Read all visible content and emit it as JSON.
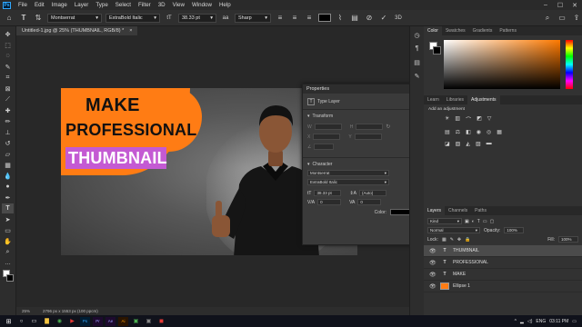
{
  "menu": {
    "logo": "Ps",
    "items": [
      "File",
      "Edit",
      "Image",
      "Layer",
      "Type",
      "Select",
      "Filter",
      "3D",
      "View",
      "Window",
      "Help"
    ]
  },
  "options_bar": {
    "font_family": "Montserrat",
    "font_style": "ExtraBold Italic",
    "font_size": "38.33 pt",
    "antialias": "Sharp",
    "text_color": "#000000"
  },
  "document": {
    "tab_title": "Untitled-1.jpg @ 25% (THUMBNAIL, RGB/8) *",
    "tab_close": "×",
    "thumbnail": {
      "line1": "MAKE",
      "line2": "PROFESSIONAL",
      "line3": "THUMBNAIL"
    }
  },
  "properties": {
    "title": "Properties",
    "type_layer": "Type Layer",
    "transform_label": "Transform",
    "character_label": "Character",
    "font_family": "Montserrat",
    "font_style": "ExtraBold Italic",
    "font_size": "38.33 pt",
    "leading": "(Auto)",
    "tracking": "0",
    "kerning_a": "0",
    "color_label": "Color:"
  },
  "right_panel": {
    "color_tabs": [
      "Color",
      "Swatches",
      "Gradients",
      "Patterns"
    ],
    "adjust_tabs": [
      "Learn",
      "Libraries",
      "Adjustments"
    ],
    "adjust_hint": "Add an adjustment",
    "layers_tabs": [
      "Layers",
      "Channels",
      "Paths"
    ],
    "kind_label": "Kind",
    "blend_mode": "Normal",
    "opacity_label": "Opacity:",
    "opacity_value": "100%",
    "lock_label": "Lock:",
    "fill_label": "Fill:",
    "fill_value": "100%",
    "layers": [
      {
        "name": "THUMBNAIL",
        "kind": "T",
        "selected": true
      },
      {
        "name": "PROFESSIONAL",
        "kind": "T",
        "selected": false
      },
      {
        "name": "MAKE",
        "kind": "T",
        "selected": false
      },
      {
        "name": "Ellipse 1",
        "kind": "shape",
        "selected": false
      }
    ]
  },
  "status": {
    "zoom": "25%",
    "doc_size": "2796 px x 1553 px (100 ppcm)"
  },
  "taskbar": {
    "time": "03:11 PM",
    "lang": "ENG"
  },
  "colors": {
    "accent_orange": "#ff7c14",
    "highlight_purple": "#c45ad3",
    "ps_blue": "#31a8ff"
  }
}
